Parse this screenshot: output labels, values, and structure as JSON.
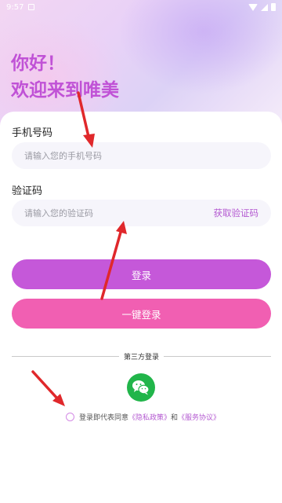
{
  "status_bar": {
    "time": "9:57"
  },
  "greeting": {
    "line1": "你好！",
    "line2": "欢迎来到唯美"
  },
  "phone": {
    "label": "手机号码",
    "placeholder": "请输入您的手机号码"
  },
  "code": {
    "label": "验证码",
    "placeholder": "请输入您的验证码",
    "get_code": "获取验证码"
  },
  "buttons": {
    "login": "登录",
    "one_key": "一键登录"
  },
  "third_party": {
    "title": "第三方登录",
    "wechat_icon": "wechat-icon"
  },
  "agreement": {
    "prefix": "登录即代表同意",
    "privacy": "《隐私政策》",
    "and": "和",
    "terms": "《服务协议》"
  },
  "colors": {
    "accent_purple": "#c558d9",
    "accent_pink": "#f15fb2",
    "wechat_green": "#21b54a",
    "annotation_red": "#e0282b"
  }
}
